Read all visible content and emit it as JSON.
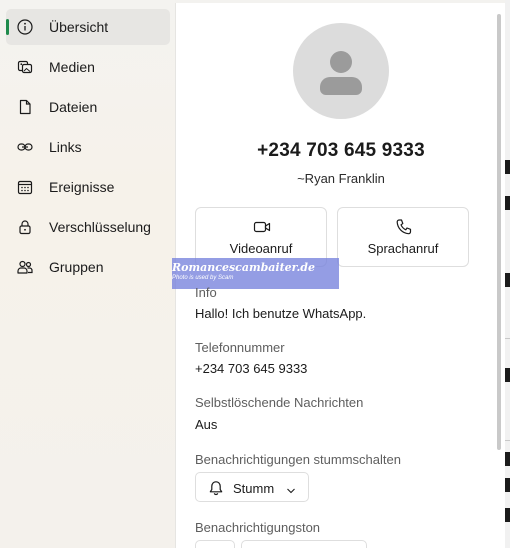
{
  "sidebar": {
    "items": [
      {
        "label": "Übersicht",
        "icon": "info-icon",
        "active": true
      },
      {
        "label": "Medien",
        "icon": "media-icon",
        "active": false
      },
      {
        "label": "Dateien",
        "icon": "file-icon",
        "active": false
      },
      {
        "label": "Links",
        "icon": "link-icon",
        "active": false
      },
      {
        "label": "Ereignisse",
        "icon": "calendar-icon",
        "active": false
      },
      {
        "label": "Verschlüsselung",
        "icon": "lock-icon",
        "active": false
      },
      {
        "label": "Gruppen",
        "icon": "people-icon",
        "active": false
      }
    ]
  },
  "contact": {
    "phone": "+234 703 645 9333",
    "display_name": "~Ryan Franklin"
  },
  "actions": {
    "video_call": "Videoanruf",
    "voice_call": "Sprachanruf"
  },
  "watermark": {
    "title": "Romancescambaiter.de",
    "subtitle": "Photo is used by Scam"
  },
  "details": {
    "info_label": "Info",
    "info_value": "Hallo! Ich benutze WhatsApp.",
    "phone_label": "Telefonnummer",
    "phone_value": "+234 703 645 9333",
    "disappearing_label": "Selbstlöschende Nachrichten",
    "disappearing_value": "Aus",
    "mute_label": "Benachrichtigungen stummschalten",
    "mute_value": "Stumm",
    "tone_label": "Benachrichtigungston"
  },
  "colors": {
    "accent": "#1f8b4c",
    "avatar_bg": "#dcdcdc",
    "avatar_fg": "#9b9b9b",
    "watermark_bg": "#7682dc"
  }
}
